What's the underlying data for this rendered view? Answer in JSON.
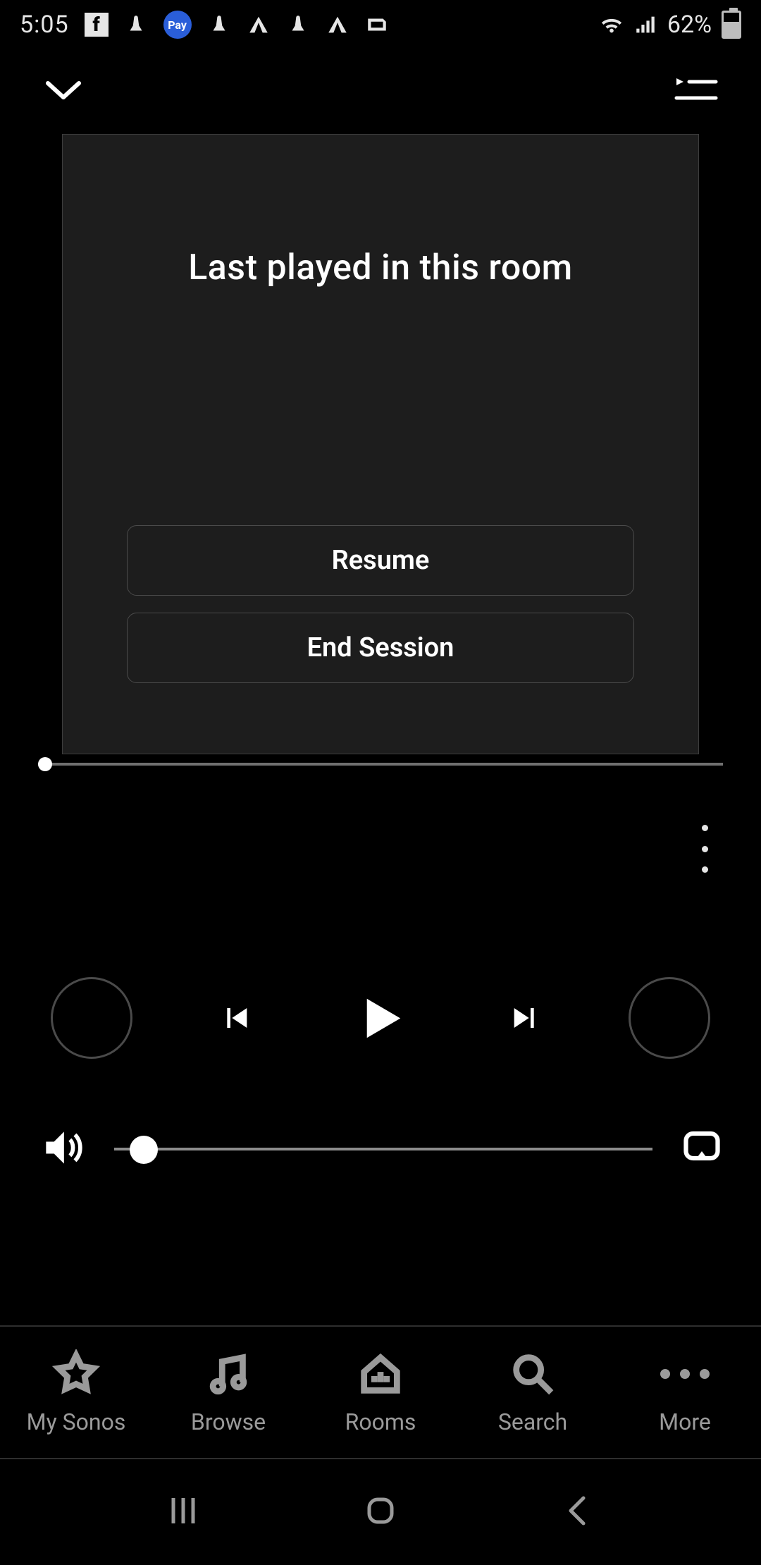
{
  "status": {
    "time": "5:05",
    "battery_pct": "62%",
    "icons": [
      "facebook",
      "praying",
      "pay",
      "praying",
      "tent",
      "praying",
      "tent",
      "vpn"
    ],
    "right_icons": [
      "wifi",
      "signal"
    ]
  },
  "card": {
    "title": "Last played in this room",
    "resume_label": "Resume",
    "end_label": "End Session"
  },
  "tabs": {
    "my_sonos": "My Sonos",
    "browse": "Browse",
    "rooms": "Rooms",
    "search": "Search",
    "more": "More"
  }
}
